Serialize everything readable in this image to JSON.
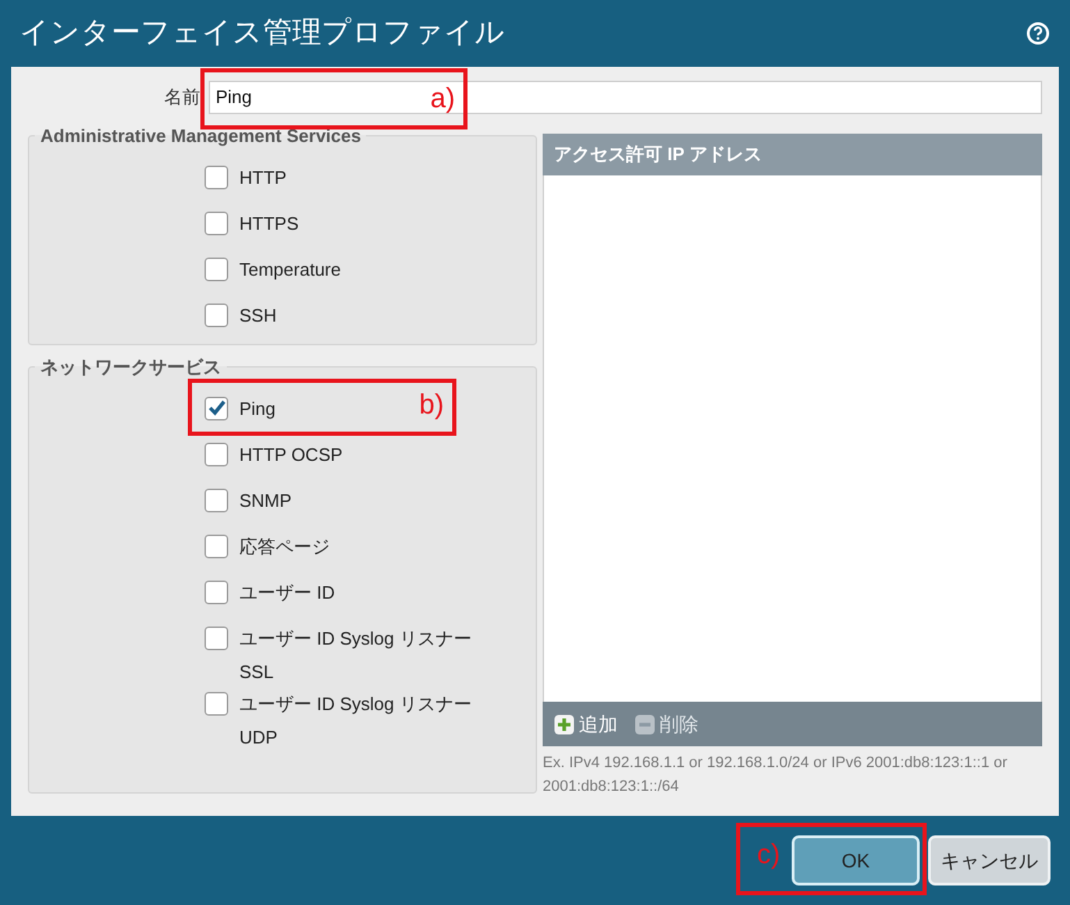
{
  "window": {
    "title": "インターフェイス管理プロファイル"
  },
  "name_field": {
    "label": "名前",
    "value": "Ping",
    "callout": "a)"
  },
  "groups": [
    {
      "title": "Administrative Management Services",
      "items": [
        {
          "label": "HTTP",
          "checked": false
        },
        {
          "label": "HTTPS",
          "checked": false
        },
        {
          "label": "Temperature",
          "checked": false
        },
        {
          "label": "SSH",
          "checked": false
        }
      ]
    },
    {
      "title": "ネットワークサービス",
      "items": [
        {
          "label": "Ping",
          "checked": true,
          "callout": "b)"
        },
        {
          "label": "HTTP OCSP",
          "checked": false
        },
        {
          "label": "SNMP",
          "checked": false
        },
        {
          "label": "応答ページ",
          "checked": false
        },
        {
          "label": "ユーザー ID",
          "checked": false
        },
        {
          "label": "ユーザー ID Syslog リスナー SSL",
          "checked": false
        },
        {
          "label": "ユーザー ID Syslog リスナー UDP",
          "checked": false
        }
      ]
    }
  ],
  "ip_list": {
    "header": "アクセス許可 IP アドレス",
    "add": {
      "label": "追加",
      "disabled": false
    },
    "delete": {
      "label": "削除",
      "disabled": true
    },
    "hint": "Ex. IPv4 192.168.1.1 or 192.168.1.0/24 or IPv6 2001:db8:123:1::1 or 2001:db8:123:1::/64"
  },
  "buttons": [
    {
      "label": "OK",
      "kind": "primary",
      "callout": "c)"
    },
    {
      "label": "キャンセル",
      "kind": "secondary"
    }
  ]
}
